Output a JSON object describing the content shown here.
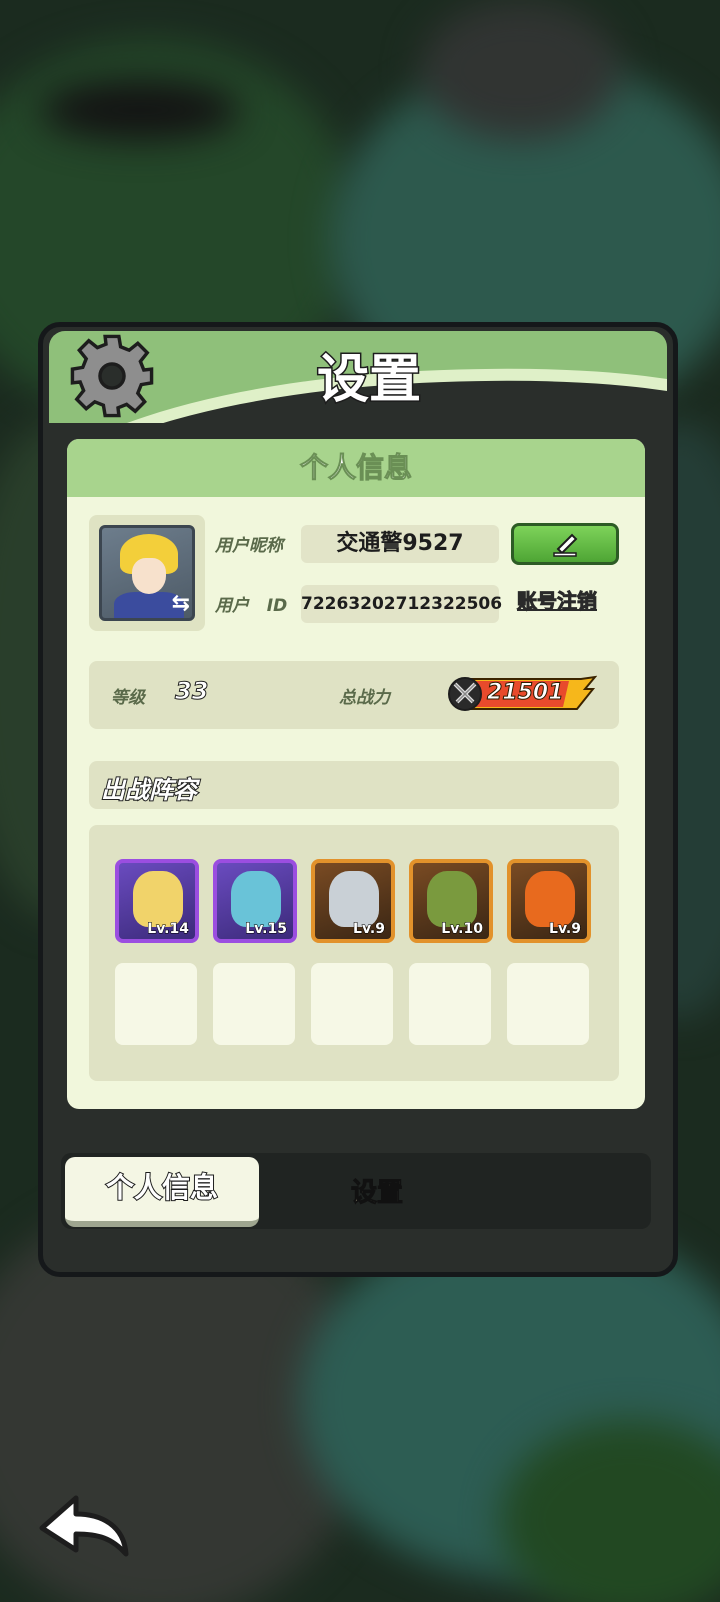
{
  "panel": {
    "title": "设置"
  },
  "personal_info": {
    "section_title": "个人信息",
    "nickname_label": "用户昵称",
    "nickname_value": "交通警9527",
    "id_label": "用户",
    "id_suffix": "ID",
    "id_value": "72263202712322506",
    "account_cancel_label": "账号注销"
  },
  "stats": {
    "level_label": "等级",
    "level_value": "33",
    "power_label": "总战力",
    "power_value": "21501"
  },
  "lineup": {
    "title": "出战阵容",
    "heroes": [
      {
        "level": "Lv.14",
        "rarity": "epic",
        "color": "#f1d36a"
      },
      {
        "level": "Lv.15",
        "rarity": "epic",
        "color": "#69c3d8"
      },
      {
        "level": "Lv.9",
        "rarity": "legend",
        "color": "#c9d0d6"
      },
      {
        "level": "Lv.10",
        "rarity": "legend",
        "color": "#7a9a3e"
      },
      {
        "level": "Lv.9",
        "rarity": "legend",
        "color": "#e86a1e"
      }
    ],
    "empty_slots": 5
  },
  "tabs": {
    "active": "个人信息",
    "inactive": "设置"
  },
  "icons": {
    "gear": "gear-icon",
    "edit": "pencil-icon",
    "power": "crossed-swords-icon",
    "back": "back-arrow-icon",
    "swap": "swap-arrows-icon"
  },
  "colors": {
    "header_green": "#8fc07a",
    "section_green": "#a8d48d",
    "content_bg": "#f1f7dc",
    "edit_button": "#5cbc3e",
    "epic_border": "#9b4ee0",
    "legend_border": "#e2922b"
  }
}
